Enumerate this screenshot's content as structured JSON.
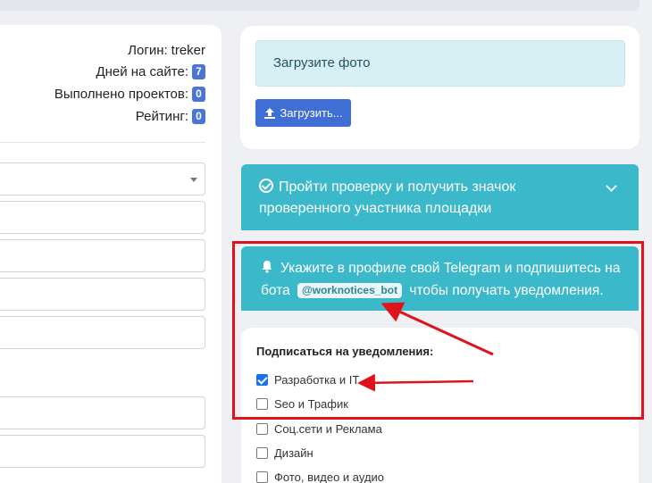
{
  "profile": {
    "login_label": "Логин:",
    "login_value": "treker",
    "days_label": "Дней на сайте:",
    "days_value": "7",
    "projects_label": "Выполнено проектов:",
    "projects_value": "0",
    "rating_label": "Рейтинг:",
    "rating_value": "0"
  },
  "upload": {
    "alert_text": "Загрузите фото",
    "button_label": "Загрузить..."
  },
  "verify": {
    "text": "Пройти проверку и получить значок проверенного участника площадки"
  },
  "telegram": {
    "text_before": "Укажите в профиле свой Telegram и подпишитесь на бота",
    "bot_name": "@worknotices_bot",
    "text_after": "чтобы получать уведомления."
  },
  "subscriptions": {
    "title": "Подписаться на уведомления:",
    "items": [
      {
        "label": "Разработка и IT",
        "checked": true
      },
      {
        "label": "Seo и Трафик",
        "checked": false
      },
      {
        "label": "Соц.сети и Реклама",
        "checked": false
      },
      {
        "label": "Дизайн",
        "checked": false
      },
      {
        "label": "Фото, видео и аудио",
        "checked": false
      }
    ]
  },
  "colors": {
    "accent_blue": "#3f6fd4",
    "teal": "#3bb9cb",
    "annotation_red": "#e0131c"
  }
}
